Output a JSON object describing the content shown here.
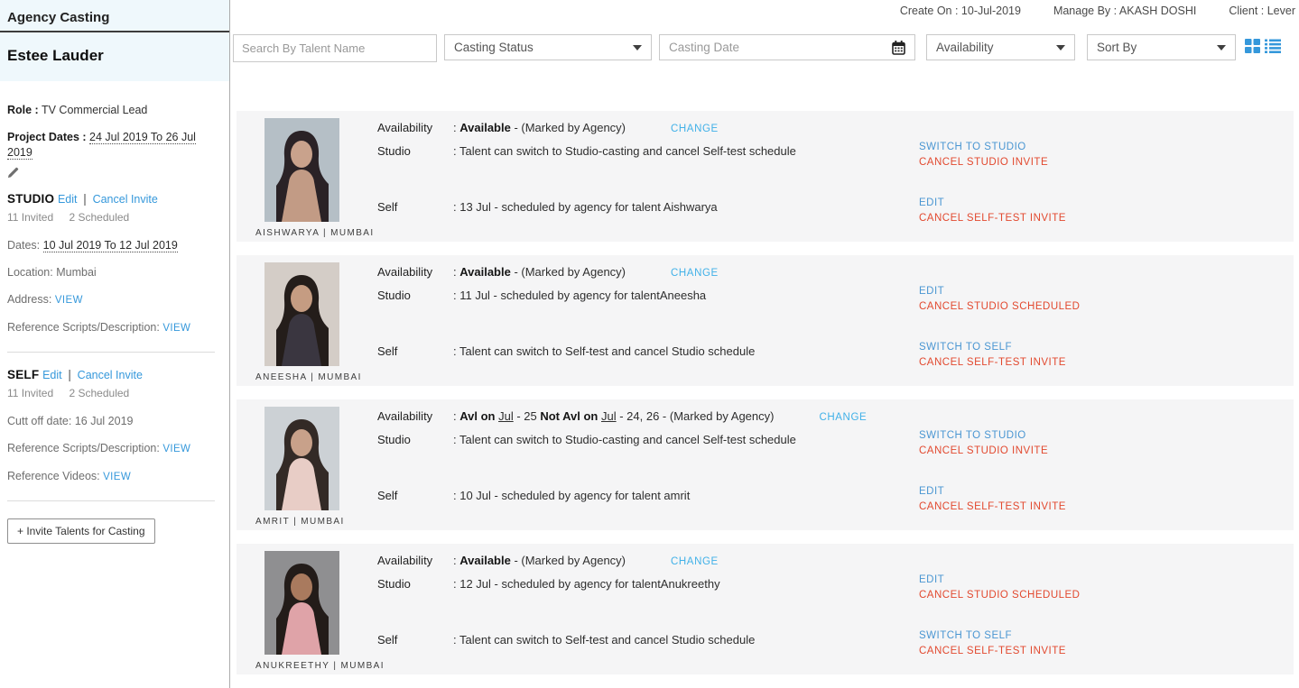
{
  "colors": {
    "accent_blue": "#3598db",
    "action_blue": "#4a96d2",
    "change_blue": "#41b1e8",
    "action_red": "#e2492f",
    "row_bg": "#f5f5f6",
    "sidebar_band_bg": "#eff8fc"
  },
  "sidebar": {
    "header": "Agency Casting",
    "brand": "Estee Lauder",
    "role_label": "Role :",
    "role_value": "TV Commercial Lead",
    "project_dates_label": "Project Dates :",
    "project_dates_value": "24 Jul 2019 To 26 Jul 2019",
    "pencil_icon": "pencil-icon",
    "studio": {
      "title": "STUDIO",
      "edit": "Edit",
      "sep": "|",
      "cancel_invite": "Cancel Invite",
      "invited": "11 Invited",
      "scheduled": "2 Scheduled",
      "dates_label": "Dates:",
      "dates_value": "10 Jul 2019 To 12 Jul 2019",
      "location_label": "Location:",
      "location_value": "Mumbai",
      "address_label": "Address:",
      "address_view": "VIEW",
      "ref_scripts_label": "Reference Scripts/Description:",
      "ref_scripts_view": "VIEW"
    },
    "self": {
      "title": "SELF",
      "edit": "Edit",
      "sep": "|",
      "cancel_invite": "Cancel Invite",
      "invited": "11 Invited",
      "scheduled": "2 Scheduled",
      "cutoff_label": "Cutt off date:",
      "cutoff_value": "16 Jul 2019",
      "ref_scripts_label": "Reference Scripts/Description:",
      "ref_scripts_view": "VIEW",
      "ref_videos_label": "Reference Videos:",
      "ref_videos_view": "VIEW"
    },
    "invite_button": "+ Invite Talents for Casting"
  },
  "header": {
    "create_on": "Create On : 10-Jul-2019",
    "manage_by": "Manage By : AKASH DOSHI",
    "client": "Client : Lever"
  },
  "filters": {
    "search_placeholder": "Search By Talent Name",
    "casting_status": "Casting Status",
    "casting_date": "Casting Date",
    "availability": "Availability",
    "sort_by": "Sort By",
    "calendar_icon": "calendar-icon",
    "grid_icon": "grid-view-icon",
    "list_icon": "list-view-icon"
  },
  "labels": {
    "availability": "Availability",
    "studio": "Studio",
    "self": "Self"
  },
  "talents": [
    {
      "name": "AISHWARYA | MUMBAI",
      "photo": {
        "bg": "#b5bfc6",
        "hair": "#2a2226",
        "skin": "#c9a28c",
        "dress": "#c29b85"
      },
      "availability_parts": [
        {
          "text": ": "
        },
        {
          "text": "Available",
          "bold": true
        },
        {
          "text": " - (Marked by Agency)"
        }
      ],
      "change_label": "CHANGE",
      "studio_text": ": Talent can switch to Studio-casting and cancel Self-test schedule",
      "self_text": ": 13 Jul - scheduled by agency for talent Aishwarya",
      "studio_actions": [
        {
          "label": "SWITCH TO STUDIO",
          "color": "blue"
        },
        {
          "label": "CANCEL STUDIO INVITE",
          "color": "red"
        }
      ],
      "self_actions": [
        {
          "label": "EDIT",
          "color": "blue"
        },
        {
          "label": "CANCEL SELF-TEST INVITE",
          "color": "red"
        }
      ]
    },
    {
      "name": "ANEESHA | MUMBAI",
      "photo": {
        "bg": "#d4cdc7",
        "hair": "#241d1a",
        "skin": "#c59c82",
        "dress": "#3a3640"
      },
      "availability_parts": [
        {
          "text": ": "
        },
        {
          "text": "Available",
          "bold": true
        },
        {
          "text": " - (Marked by Agency)"
        }
      ],
      "change_label": "CHANGE",
      "studio_text": ": 11 Jul - scheduled by agency for talentAneesha",
      "self_text": ": Talent can switch to Self-test and cancel Studio schedule",
      "studio_actions": [
        {
          "label": "EDIT",
          "color": "blue"
        },
        {
          "label": "CANCEL STUDIO SCHEDULED",
          "color": "red"
        }
      ],
      "self_actions": [
        {
          "label": "SWITCH TO SELF",
          "color": "blue"
        },
        {
          "label": "CANCEL SELF-TEST INVITE",
          "color": "red"
        }
      ]
    },
    {
      "name": "AMRIT | MUMBAI",
      "photo": {
        "bg": "#ccd1d5",
        "hair": "#332a26",
        "skin": "#c8a18a",
        "dress": "#e8cdc6"
      },
      "availability_parts": [
        {
          "text": ": "
        },
        {
          "text": "Avl on ",
          "bold": true
        },
        {
          "text": "Jul",
          "underline": true
        },
        {
          "text": " - 25 "
        },
        {
          "text": " Not Avl on ",
          "bold": true
        },
        {
          "text": "Jul",
          "underline": true
        },
        {
          "text": " - 24, 26 "
        },
        {
          "text": " - (Marked by Agency)"
        }
      ],
      "change_label": "CHANGE",
      "studio_text": ": Talent can switch to Studio-casting and cancel Self-test schedule",
      "self_text": ": 10 Jul - scheduled by agency for talent amrit",
      "studio_actions": [
        {
          "label": "SWITCH TO STUDIO",
          "color": "blue"
        },
        {
          "label": "CANCEL STUDIO INVITE",
          "color": "red"
        }
      ],
      "self_actions": [
        {
          "label": "EDIT",
          "color": "blue"
        },
        {
          "label": "CANCEL SELF-TEST INVITE",
          "color": "red"
        }
      ]
    },
    {
      "name": "ANUKREETHY | MUMBAI",
      "photo": {
        "bg": "#8f8f91",
        "hair": "#231c19",
        "skin": "#a97a5e",
        "dress": "#dfa3a8"
      },
      "availability_parts": [
        {
          "text": ": "
        },
        {
          "text": "Available",
          "bold": true
        },
        {
          "text": " - (Marked by Agency)"
        }
      ],
      "change_label": "CHANGE",
      "studio_text": ": 12 Jul - scheduled by agency for talentAnukreethy",
      "self_text": ": Talent can switch to Self-test and cancel Studio schedule",
      "studio_actions": [
        {
          "label": "EDIT",
          "color": "blue"
        },
        {
          "label": "CANCEL STUDIO SCHEDULED",
          "color": "red"
        }
      ],
      "self_actions": [
        {
          "label": "SWITCH TO SELF",
          "color": "blue"
        },
        {
          "label": "CANCEL SELF-TEST INVITE",
          "color": "red"
        }
      ]
    }
  ]
}
